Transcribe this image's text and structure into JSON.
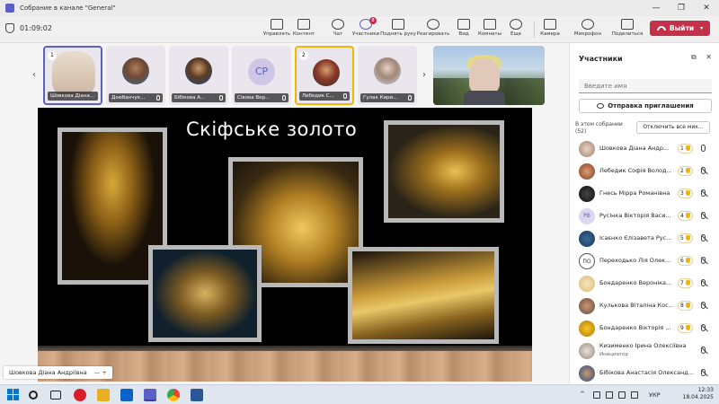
{
  "window": {
    "title": "Собрание в канале \"General\"",
    "controls": [
      "—",
      "❐",
      "✕"
    ]
  },
  "toolbar": {
    "timer": "01:09:02",
    "buttons": [
      {
        "label": "Управлять",
        "icon": "share-screen-icon"
      },
      {
        "label": "Контент",
        "icon": "content-icon"
      },
      {
        "label": "Чат",
        "icon": "chat-icon"
      },
      {
        "label": "Участники",
        "icon": "people-icon",
        "badge": "8"
      },
      {
        "label": "Поднять руку",
        "icon": "hand-icon"
      },
      {
        "label": "Реагировать",
        "icon": "emoji-icon"
      },
      {
        "label": "Вид",
        "icon": "grid-icon"
      },
      {
        "label": "Комнаты",
        "icon": "rooms-icon"
      },
      {
        "label": "Еще",
        "icon": "more-icon"
      },
      {
        "label": "Камера",
        "icon": "camera-icon"
      },
      {
        "label": "Микрофон",
        "icon": "mic-off-icon"
      },
      {
        "label": "Поделиться",
        "icon": "share-icon"
      }
    ],
    "leave_label": "Выйти"
  },
  "gallery": {
    "tiles": [
      {
        "name": "Шовкова Діана...",
        "badge": "1"
      },
      {
        "name": "Дзюбанчук..."
      },
      {
        "name": "Бібікова А..."
      },
      {
        "name": "Сівова Вер...",
        "initials": "СР"
      },
      {
        "name": "Лебедик С...",
        "badge": "2"
      },
      {
        "name": "Гулак Кири..."
      }
    ]
  },
  "slide": {
    "title": "Скіфське золото",
    "presenter": "Шовкова Діана Андріївна",
    "presenter_controls": "— +"
  },
  "panel": {
    "title": "Участники",
    "search_placeholder": "Введите имя",
    "invite_label": "Отправка приглашения",
    "section": "В этом собрании (52)",
    "mute_all": "Отключить все мик...",
    "participants": [
      {
        "name": "Шовкова Діана Андр...",
        "hand": "1",
        "mic": "on"
      },
      {
        "name": "Лебедик Софія Волод...",
        "hand": "2",
        "mic": "off"
      },
      {
        "name": "Гнесь Мірра Романівна",
        "hand": "3",
        "mic": "off"
      },
      {
        "name": "Русінка Вікторія Васи...",
        "initials": "РВ",
        "hand": "4",
        "mic": "off"
      },
      {
        "name": "Ісаєнко Єлізавета Рус...",
        "hand": "5",
        "mic": "off"
      },
      {
        "name": "Переходько Лія Олек...",
        "initials": "ПО",
        "hand": "6",
        "mic": "off"
      },
      {
        "name": "Бондаренко Вероніка...",
        "hand": "7",
        "mic": "off"
      },
      {
        "name": "Кулькова Віталіна Кос...",
        "hand": "8",
        "mic": "off"
      },
      {
        "name": "Бондаренко Вікторія ...",
        "hand": "9",
        "mic": "off"
      },
      {
        "name": "Кизименко Ірина Олексіївна",
        "role": "Инициатор",
        "mic": "off"
      },
      {
        "name": "Бібікова Анастасія Олександ...",
        "mic": "off"
      }
    ]
  },
  "taskbar": {
    "lang": "УКР",
    "time": "12:33",
    "date": "18.04.2025"
  },
  "colors": {
    "accent": "#5b5fc7",
    "leave": "#c4314b",
    "hand": "#f2b600"
  }
}
